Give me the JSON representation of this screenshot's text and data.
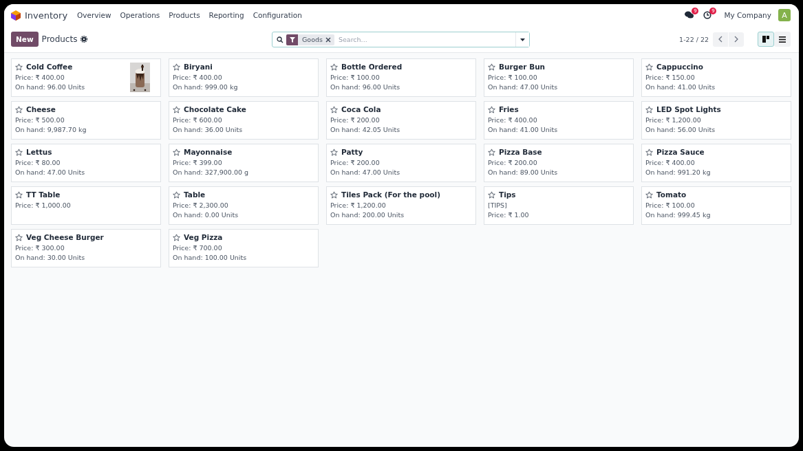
{
  "navbar": {
    "app": "Inventory",
    "menu": [
      "Overview",
      "Operations",
      "Products",
      "Reporting",
      "Configuration"
    ],
    "messages_badge": "9",
    "activities_badge": "9",
    "company": "My Company",
    "avatar": "A"
  },
  "control_panel": {
    "new_button": "New",
    "title": "Products",
    "search": {
      "facet": "Goods",
      "placeholder": "Search..."
    },
    "pager": "1-22 / 22",
    "views": [
      {
        "kind": "kanban",
        "selected": true
      },
      {
        "kind": "list",
        "selected": false
      }
    ]
  },
  "cards": [
    {
      "name": "Cold Coffee",
      "starred": false,
      "lines": [
        "Price: ₹ 400.00",
        "On hand: 96.00 Units"
      ]
    },
    {
      "name": "Biryani",
      "starred": false,
      "lines": [
        "Price: ₹ 400.00",
        "On hand: 999.00 kg"
      ]
    },
    {
      "name": "Bottle Ordered",
      "starred": false,
      "lines": [
        "Price: ₹ 100.00",
        "On hand: 96.00 Units"
      ]
    },
    {
      "name": "Burger Bun",
      "starred": false,
      "lines": [
        "Price: ₹ 100.00",
        "On hand: 47.00 Units"
      ]
    },
    {
      "name": "Cappuccino",
      "starred": false,
      "lines": [
        "Price: ₹ 150.00",
        "On hand: 41.00 Units"
      ]
    },
    {
      "name": "Cheese",
      "starred": false,
      "lines": [
        "Price: ₹ 500.00",
        "On hand: 9,987.70 kg"
      ]
    },
    {
      "name": "Chocolate Cake",
      "starred": false,
      "lines": [
        "Price: ₹ 600.00",
        "On hand: 36.00 Units"
      ]
    },
    {
      "name": "Coca Cola",
      "starred": false,
      "lines": [
        "Price: ₹ 200.00",
        "On hand: 42.05 Units"
      ]
    },
    {
      "name": "Fries",
      "starred": false,
      "lines": [
        "Price: ₹ 400.00",
        "On hand: 41.00 Units"
      ]
    },
    {
      "name": "LED Spot Lights",
      "starred": false,
      "lines": [
        "Price: ₹ 1,200.00",
        "On hand: 56.00 Units"
      ]
    },
    {
      "name": "Lettus",
      "starred": false,
      "lines": [
        "Price: ₹ 80.00",
        "On hand: 47.00 Units"
      ]
    },
    {
      "name": "Mayonnaise",
      "starred": false,
      "lines": [
        "Price: ₹ 399.00",
        "On hand: 327,900.00 g"
      ]
    },
    {
      "name": "Patty",
      "starred": false,
      "lines": [
        "Price: ₹ 200.00",
        "On hand: 47.00 Units"
      ]
    },
    {
      "name": "Pizza Base",
      "starred": false,
      "lines": [
        "Price: ₹ 200.00",
        "On hand: 89.00 Units"
      ]
    },
    {
      "name": "Pizza Sauce",
      "starred": false,
      "lines": [
        "Price: ₹ 400.00",
        "On hand: 991.20 kg"
      ]
    },
    {
      "name": "TT Table",
      "starred": false,
      "lines": [
        "Price: ₹ 1,000.00"
      ]
    },
    {
      "name": "Table",
      "starred": false,
      "lines": [
        "Price: ₹ 2,300.00",
        "On hand: 0.00 Units"
      ]
    },
    {
      "name": "Tiles Pack (For the pool)",
      "starred": false,
      "lines": [
        "Price: ₹ 1,200.00",
        "On hand: 200.00 Units"
      ]
    },
    {
      "name": "Tips",
      "starred": false,
      "lines": [
        "[TIPS]",
        "Price: ₹ 1.00"
      ]
    },
    {
      "name": "Tomato",
      "starred": false,
      "lines": [
        "Price: ₹ 100.00",
        "On hand: 999.45 kg"
      ]
    },
    {
      "name": "Veg Cheese Burger",
      "starred": false,
      "lines": [
        "Price: ₹ 300.00",
        "On hand: 30.00 Units"
      ]
    },
    {
      "name": "Veg Pizza",
      "starred": false,
      "lines": [
        "Price: ₹ 700.00",
        "On hand: 100.00 Units"
      ]
    }
  ]
}
